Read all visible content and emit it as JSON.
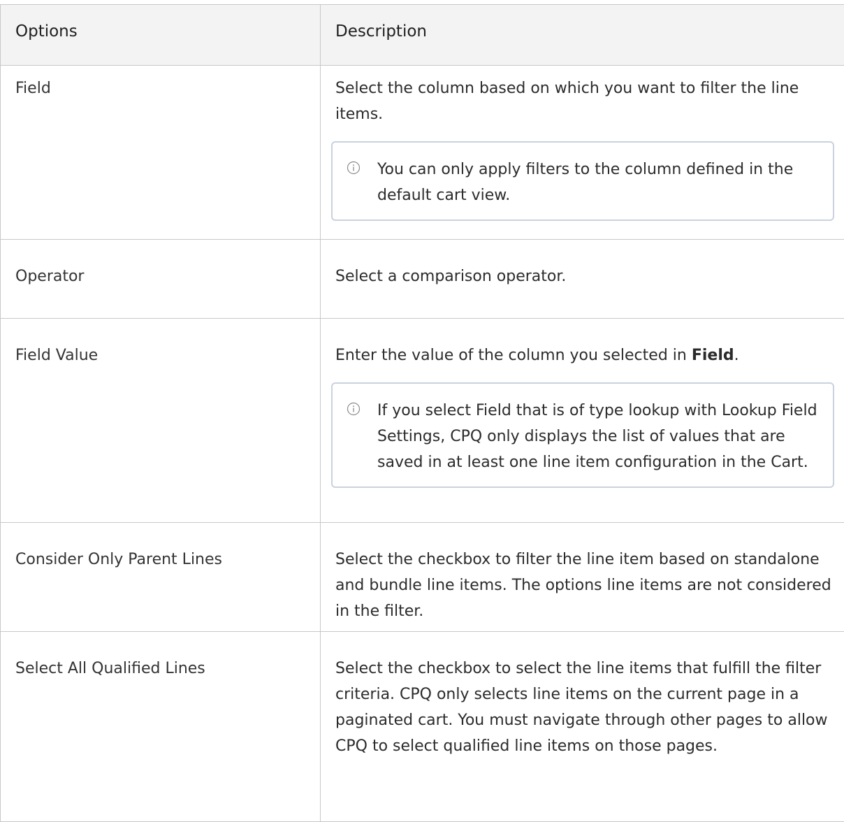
{
  "table": {
    "headers": {
      "options": "Options",
      "description": "Description"
    },
    "rows": {
      "field": {
        "option": "Field",
        "description": "Select the column based on which you want to filter the line items.",
        "note": "You can only apply filters to the column defined in the default cart view."
      },
      "operator": {
        "option": "Operator",
        "description": "Select a comparison operator."
      },
      "field_value": {
        "option": "Field Value",
        "description_prefix": "Enter the value of the column you selected in ",
        "description_bold": "Field",
        "description_suffix": ".",
        "note": "If you select Field that is of type lookup with Lookup Field Settings, CPQ only displays the list of values that are saved in at least one line item configuration in the Cart."
      },
      "parent_lines": {
        "option": "Consider Only Parent Lines",
        "description": "Select the checkbox to filter the line item based on standalone and bundle line items. The options line items are not considered in the filter."
      },
      "qualified_lines": {
        "option": "Select All Qualified Lines",
        "description": "Select the checkbox to select the line items that fulfill the filter criteria. CPQ only selects line items on the current page in a paginated cart. You must navigate through other pages to allow CPQ to select qualified line items on those pages."
      }
    }
  },
  "icons": {
    "note_icon": "info-circle-icon"
  },
  "colors": {
    "header_bg": "#f3f3f3",
    "border": "#c8c8c8",
    "note_border": "#c9d2de",
    "text": "#2b2b2b"
  }
}
